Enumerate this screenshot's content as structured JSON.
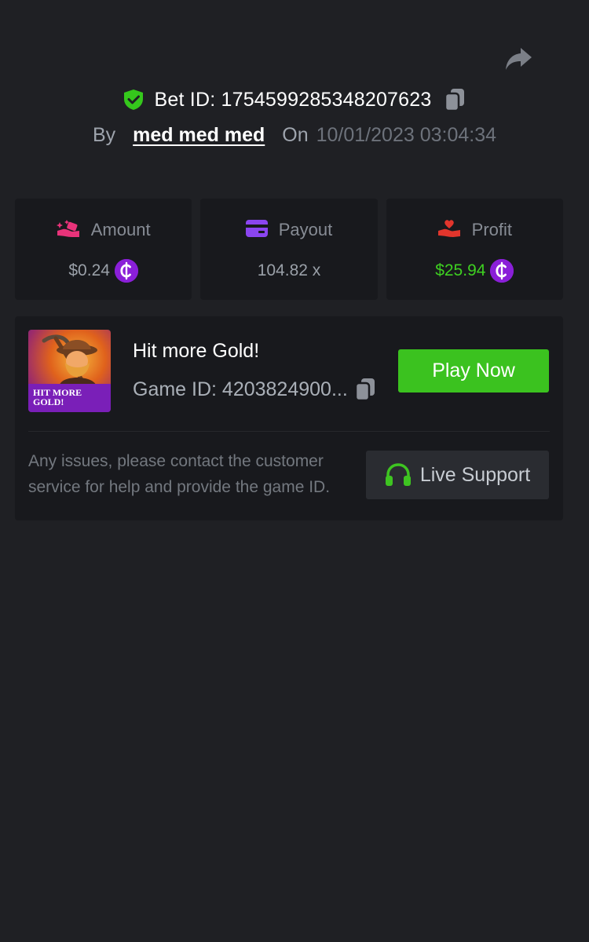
{
  "header": {
    "bet_id_label": "Bet ID: 1754599285348207623",
    "by_label": "By",
    "user_name": "med med med",
    "on_label": "On",
    "date": "10/01/2023 03:04:34"
  },
  "stats": [
    {
      "label": "Amount",
      "value": "$0.24",
      "icon": "hand-coins-icon",
      "show_coin": true,
      "value_color": "#9aa0a8"
    },
    {
      "label": "Payout",
      "value": "104.82 x",
      "icon": "card-icon",
      "show_coin": false,
      "value_color": "#9aa0a8"
    },
    {
      "label": "Profit",
      "value": "$25.94",
      "icon": "hand-heart-icon",
      "show_coin": true,
      "value_color": "#3ed021"
    }
  ],
  "coin_symbol": "₵",
  "game": {
    "thumbnail_title": "HIT MORE GOLD!",
    "title": "Hit more Gold!",
    "game_id_label": "Game ID: 4203824900...",
    "play_label": "Play Now"
  },
  "support": {
    "help_text": "Any issues, please contact the customer service for help and provide the game ID.",
    "button_label": "Live Support"
  },
  "colors": {
    "background": "#1f2024",
    "card": "#18191d",
    "accent_green": "#3bc21f",
    "coin_purple": "#8a1fd8",
    "shield_green": "#35c81c"
  }
}
